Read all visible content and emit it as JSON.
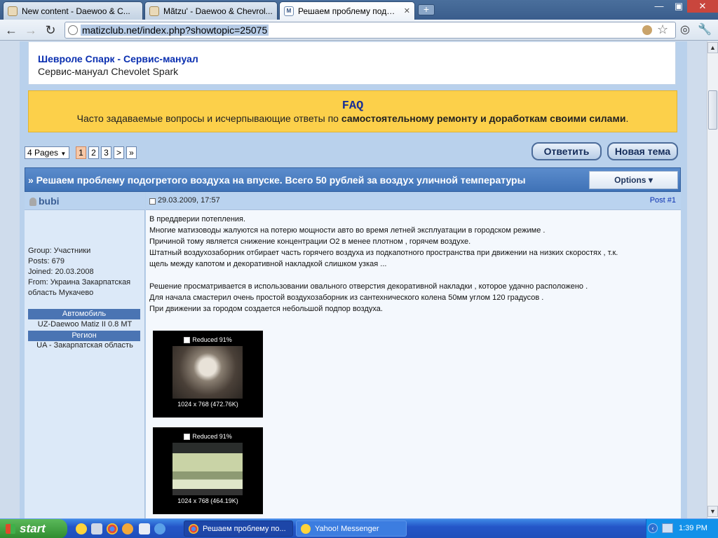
{
  "browser": {
    "tabs": [
      {
        "title": "New content - Daewoo & C...",
        "active": false
      },
      {
        "title": "Mãtzu' - Daewoo & Chevrol...",
        "active": false
      },
      {
        "title": "Решаем проблему подогр...",
        "active": true
      }
    ],
    "url": "matizclub.net/index.php?showtopic=25075"
  },
  "header": {
    "link_title": "Шевроле Спарк - Сервис-мануал",
    "subtitle": "Сервис-мануал Chevolet Spark"
  },
  "faq": {
    "title": "FAQ",
    "text_plain": "Часто задаваемые вопросы и исчерпывающие ответы по ",
    "text_bold": "самостоятельному ремонту и доработкам своими силами",
    "text_end": "."
  },
  "pagination": {
    "pages_label": "4 Pages",
    "pages": [
      "1",
      "2",
      "3"
    ],
    "next": ">",
    "last": "»"
  },
  "actions": {
    "reply": "Ответить",
    "new_topic": "Новая тема"
  },
  "topic": {
    "title": "» Решаем проблему подогретого воздуха на впуске. Всего 50 рублей за воздух уличной температуры",
    "options": "Options ▾"
  },
  "post": {
    "author": "bubi",
    "group": "Group: Участники",
    "posts": "Posts: 679",
    "joined": "Joined: 20.03.2008",
    "from_line1": "From: Украина Закарпатская",
    "from_line2": "область Мукачево",
    "car_label": "Автомобиль",
    "car_value": "UZ-Daewoo Matiz II 0.8 MT",
    "region_label": "Регион",
    "region_value": "UA - Закарпатская область",
    "date": "29.03.2009, 17:57",
    "number": "Post #1",
    "lines": [
      "В преддверии потепления.",
      "Многие матизоводы жалуются на потерю мощности авто во время летней эксплуатации в городском режиме .",
      "Причиной тому является снижение концентрации О2 в менее плотном , горячем воздухе.",
      "Штатный воздухозаборник отбирает часть горячего воздуха из подкапотного пространства при движении на низких скоростях , т.к.",
      "щель между капотом и декоративной накладкой слишком узкая ...",
      "",
      "Решение просматривается в использовании овального отверстия декоративной накладки , которое удачно расположено .",
      "Для начала смастерил очень простой воздухозаборник из сантехнического колена 50мм углом 120 градусов .",
      "При движении за городом создается небольшой подпор воздуха."
    ],
    "images": [
      {
        "reduced": "Reduced 91%",
        "caption": "1024 x 768 (472.76K)"
      },
      {
        "reduced": "Reduced 91%",
        "caption": "1024 x 768 (464.19K)"
      }
    ]
  },
  "taskbar": {
    "start": "start",
    "tasks": [
      {
        "label": "Решаем проблему по...",
        "active": true
      },
      {
        "label": "Yahoo! Messenger",
        "active": false
      }
    ],
    "clock": "1:39 PM"
  }
}
